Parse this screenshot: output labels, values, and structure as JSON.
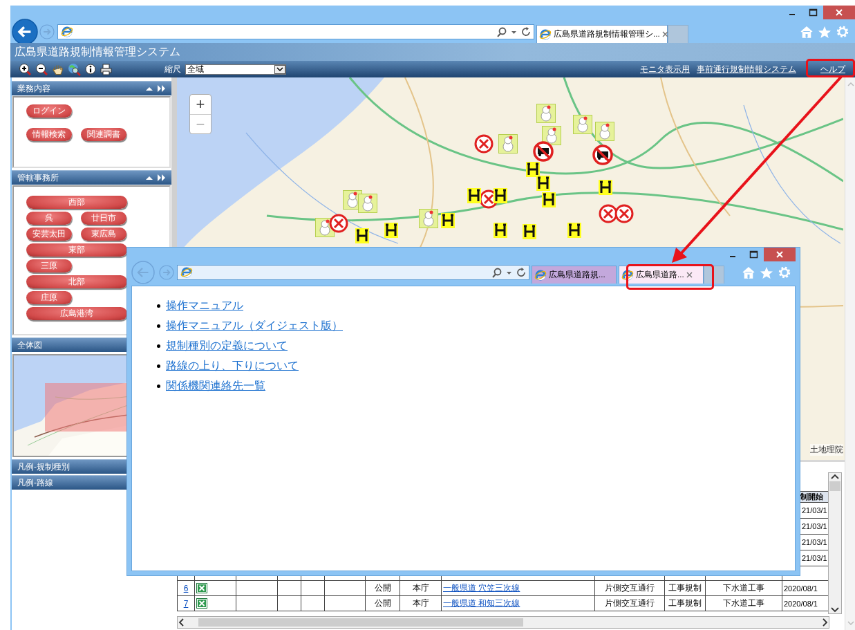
{
  "browser": {
    "tabs": [
      {
        "title": "広島県道路規制情報管理シ...",
        "selected": true
      }
    ]
  },
  "app": {
    "title": "広島県道路規制情報管理システム",
    "scale_label": "縮尺",
    "scale_value": "全域",
    "links": [
      "モニタ表示用",
      "事前通行規制情報システム",
      "ヘルプ"
    ]
  },
  "sidebar": {
    "sections": [
      {
        "title": "業務内容",
        "kind": "tasks",
        "rows": [
          [
            {
              "label": "ログイン",
              "kind": "narrow"
            }
          ],
          [
            {
              "label": "情報検索",
              "kind": "narrow"
            },
            {
              "label": "関連調書",
              "kind": "narrow"
            }
          ]
        ]
      },
      {
        "title": "管轄事務所",
        "kind": "offices",
        "rows": [
          [
            {
              "label": "西部",
              "kind": "wide"
            }
          ],
          [
            {
              "label": "呉",
              "kind": "narrow"
            },
            {
              "label": "廿日市",
              "kind": "narrow"
            }
          ],
          [
            {
              "label": "安芸太田",
              "kind": "narrow"
            },
            {
              "label": "東広島",
              "kind": "narrow"
            }
          ],
          [
            {
              "label": "東部",
              "kind": "wide"
            }
          ],
          [
            {
              "label": "三原",
              "kind": "narrow"
            }
          ],
          [
            {
              "label": "北部",
              "kind": "wide"
            }
          ],
          [
            {
              "label": "庄原",
              "kind": "narrow"
            }
          ],
          [
            {
              "label": "広島港湾",
              "kind": "wide"
            }
          ]
        ]
      },
      {
        "title": "全体図",
        "kind": "overview"
      },
      {
        "title": "凡例-規制種別",
        "kind": "legend"
      },
      {
        "title": "凡例-路線",
        "kind": "legend"
      }
    ]
  },
  "map": {
    "zoom_in": "+",
    "zoom_out": "−",
    "attribution": "土地理院"
  },
  "table": {
    "heading": "制開始",
    "rows": [
      {
        "kind": "covered",
        "date": "21/03/1"
      },
      {
        "kind": "covered",
        "date": "21/03/1"
      },
      {
        "kind": "covered",
        "date": "21/03/1"
      },
      {
        "kind": "covered",
        "date": "21/03/1"
      },
      {
        "kind": "hidden"
      },
      {
        "kind": "full",
        "no": "6",
        "status": "公開",
        "office": "本庁",
        "route": "一般県道 穴笠三次線",
        "regulation": "片側交互通行",
        "category": "工事規制",
        "work": "下水道工事",
        "date": "2020/08/1"
      },
      {
        "kind": "full",
        "no": "7",
        "status": "公開",
        "office": "本庁",
        "route": "一般県道 和知三次線",
        "regulation": "片側交互通行",
        "category": "工事規制",
        "work": "下水道工事",
        "date": "2020/08/1"
      }
    ]
  },
  "popup": {
    "tabs": [
      {
        "title": "広島県道路規...",
        "selected": false
      },
      {
        "title": "広島県道路...",
        "selected": true
      }
    ],
    "links": [
      "操作マニュアル",
      "操作マニュアル（ダイジェスト版）",
      "規制種別の定義について",
      "路線の上り、下りについて",
      "関係機関連絡先一覧"
    ]
  }
}
